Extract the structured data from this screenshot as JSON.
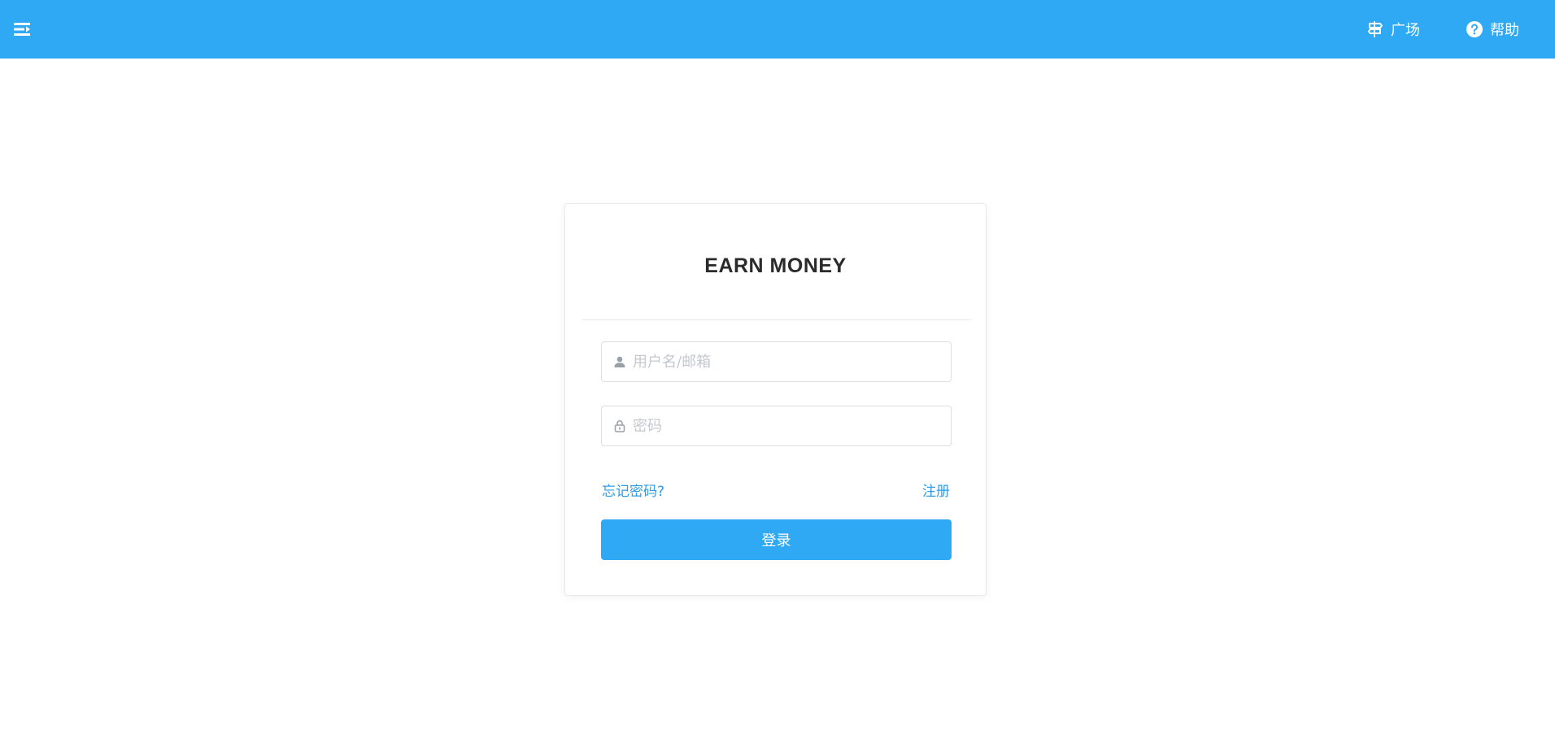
{
  "topbar": {
    "menu_icon": "menu-fold-icon",
    "nav": [
      {
        "label": "广场",
        "icon": "signpost-icon"
      },
      {
        "label": "帮助",
        "icon": "help-circle-icon"
      }
    ],
    "colors": {
      "background": "#30a9f5",
      "text": "#ffffff"
    }
  },
  "login": {
    "title": "EARN MONEY",
    "username": {
      "placeholder": "用户名/邮箱",
      "value": "",
      "icon": "user-icon"
    },
    "password": {
      "placeholder": "密码",
      "value": "",
      "icon": "lock-icon"
    },
    "forgot_label": "忘记密码?",
    "register_label": "注册",
    "submit_label": "登录",
    "colors": {
      "accent": "#30a9f5",
      "link": "#2d9ce8"
    }
  }
}
